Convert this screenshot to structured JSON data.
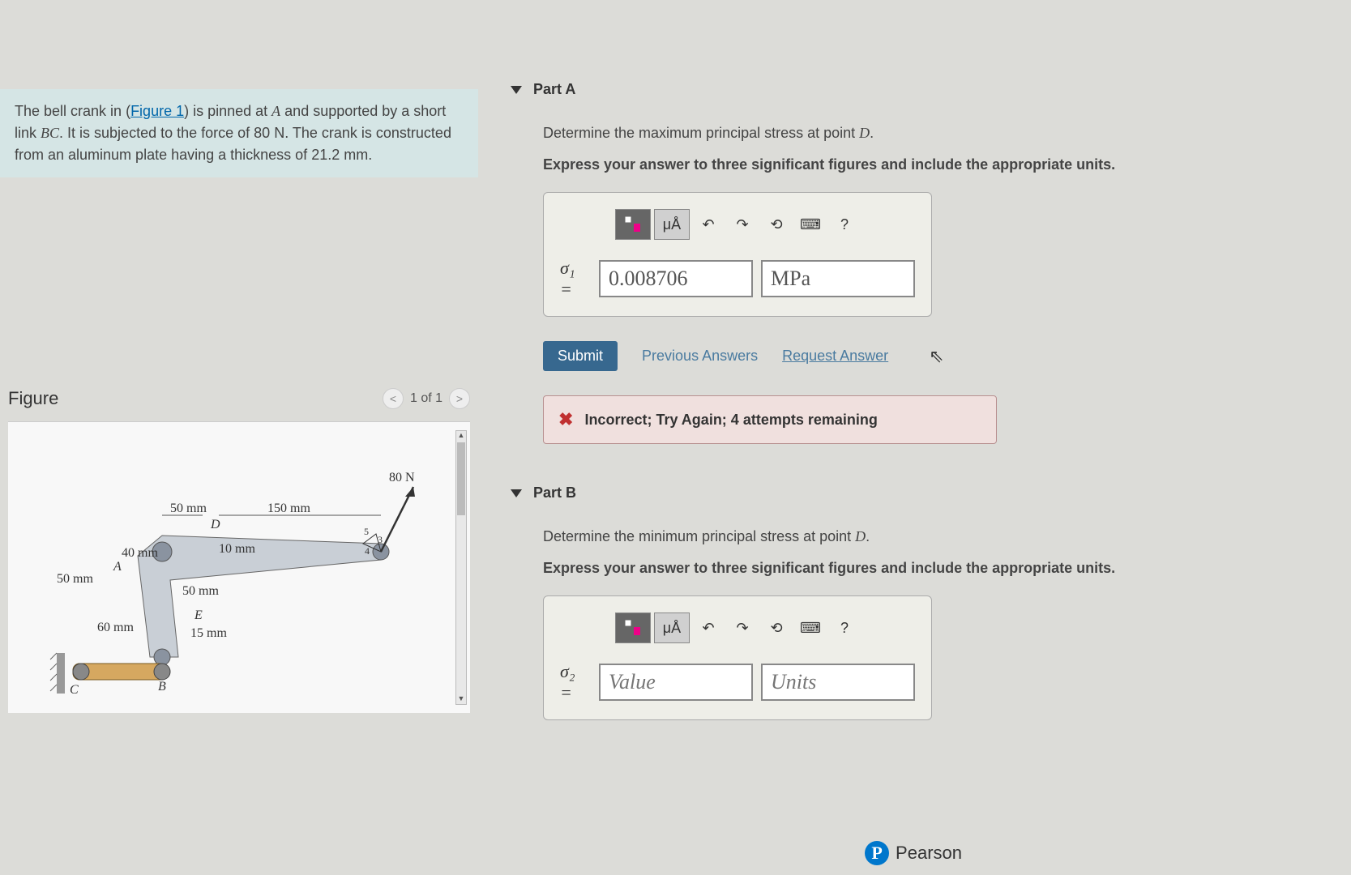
{
  "problem": {
    "text_pre": "The bell crank in (",
    "figure_link": "Figure 1",
    "text_mid1": ") is pinned at ",
    "A": "A",
    "text_mid2": " and supported by a short link ",
    "BC": "BC",
    "text_mid3": ". It is subjected to the force of 80 ",
    "N": "N",
    "text_mid4": ". The crank is constructed from an aluminum plate having a thickness of 21.2 ",
    "mm": "mm",
    "text_end": "."
  },
  "figure": {
    "title": "Figure",
    "counter": "1 of 1",
    "labels": {
      "force": "80 N",
      "d50a": "50 mm",
      "d150": "150 mm",
      "D": "D",
      "d40": "40 mm",
      "d10": "10 mm",
      "A": "A",
      "d50b": "50 mm",
      "d50c": "50 mm",
      "E": "E",
      "d60": "60 mm",
      "d15": "15 mm",
      "C": "C",
      "B": "B",
      "s5": "5",
      "s3": "3",
      "s4": "4"
    }
  },
  "partA": {
    "title": "Part A",
    "instruction1_pre": "Determine the maximum principal stress at point ",
    "instruction1_D": "D",
    "instruction1_post": ".",
    "instruction2": "Express your answer to three significant figures and include the appropriate units.",
    "sigma_label": "σ₁ =",
    "value": "0.008706",
    "units": "MPa",
    "submit": "Submit",
    "prev_answers": "Previous Answers",
    "request_answer": "Request Answer",
    "feedback": "Incorrect; Try Again; 4 attempts remaining",
    "tool_units": "μÅ",
    "tool_help": "?"
  },
  "partB": {
    "title": "Part B",
    "instruction1_pre": "Determine the minimum principal stress at point ",
    "instruction1_D": "D",
    "instruction1_post": ".",
    "instruction2": "Express your answer to three significant figures and include the appropriate units.",
    "sigma_label": "σ₂ =",
    "value_placeholder": "Value",
    "units_placeholder": "Units",
    "tool_units": "μÅ",
    "tool_help": "?"
  },
  "footer": {
    "brand": "Pearson"
  }
}
